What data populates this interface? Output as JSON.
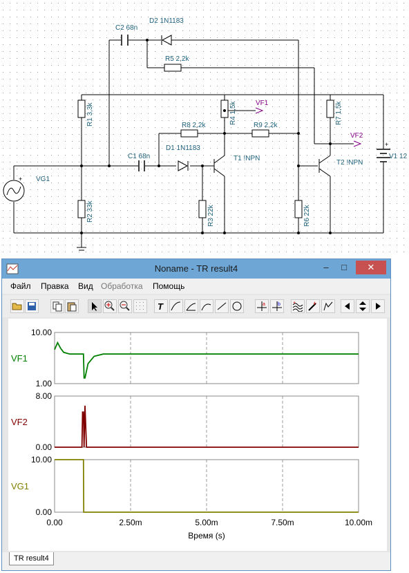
{
  "schematic": {
    "labels": {
      "c2": "C2 68n",
      "d2": "D2 1N1183",
      "r5": "R5 2,2k",
      "r1": "R1 3,3k",
      "vf1": "VF1",
      "r4": "R4 1,5k",
      "r7": "R7 1,5k",
      "r8": "R8 2,2k",
      "r9": "R9 2,2k",
      "vf2": "VF2",
      "d1": "D1 1N1183",
      "t1": "T1 !NPN",
      "vg1": "VG1",
      "c1": "C1 68n",
      "t2": "T2 !NPN",
      "v1": "V1 12",
      "r2": "R2 33k",
      "r3": "R3 22k",
      "r6": "R6 22k"
    }
  },
  "window": {
    "title": "Noname - TR result4",
    "buttons": {
      "minimize": "–",
      "maximize": "□",
      "close": "✕"
    }
  },
  "menu": [
    "Файл",
    "Правка",
    "Вид",
    "Обработка",
    "Помощь"
  ],
  "toolbar_icons": [
    "open-icon",
    "save-icon",
    "copy-icon",
    "paste-icon",
    "pointer-icon",
    "zoom-in-icon",
    "zoom-out-icon",
    "grid-icon",
    "text-icon",
    "curve-icon",
    "curve-2-icon",
    "curve-3-icon",
    "line-icon",
    "circle-icon",
    "cursor-a-icon",
    "cursor-b-icon",
    "wave-icon",
    "marker-icon",
    "probe-icon",
    "step-icon",
    "arrow-left-icon",
    "arrow-updown-icon",
    "arrow-right-icon"
  ],
  "chart_data": [
    {
      "type": "line",
      "name": "VF1",
      "ylim": [
        1.0,
        10.0
      ],
      "ytick_labels": [
        "10.00",
        "1.00"
      ],
      "color": "#008000",
      "x": [
        0.0,
        0.1,
        0.2,
        0.3,
        0.5,
        0.8,
        0.95,
        0.97,
        1.0,
        1.1,
        1.3,
        1.6,
        2.0,
        3.0,
        5.0,
        7.5,
        10.0
      ],
      "y": [
        7.0,
        8.2,
        7.2,
        6.5,
        6.2,
        6.2,
        6.2,
        2.0,
        2.0,
        4.5,
        5.8,
        6.2,
        6.2,
        6.2,
        6.2,
        6.2,
        6.2
      ]
    },
    {
      "type": "line",
      "name": "VF2",
      "ylim": [
        0.0,
        8.0
      ],
      "ytick_labels": [
        "8.00",
        "0.00"
      ],
      "color": "#800000",
      "x": [
        0.0,
        0.85,
        0.9,
        0.92,
        0.95,
        0.97,
        1.0,
        1.05,
        10.0
      ],
      "y": [
        0.0,
        0.0,
        0.0,
        5.5,
        5.5,
        0.0,
        6.5,
        0.0,
        0.0
      ]
    },
    {
      "type": "line",
      "name": "VG1",
      "ylim": [
        0.0,
        10.0
      ],
      "ytick_labels": [
        "10.00",
        "0.00"
      ],
      "color": "#808000",
      "x": [
        0.0,
        0.95,
        0.96,
        10.0
      ],
      "y": [
        10.0,
        10.0,
        0.0,
        0.0
      ]
    }
  ],
  "x_axis": {
    "xlim": [
      0.0,
      10.0
    ],
    "tick_labels": [
      "0.00",
      "2.50m",
      "5.00m",
      "7.50m",
      "10.00m"
    ],
    "xlabel": "Время (s)"
  },
  "tab": {
    "label": "TR result4"
  }
}
